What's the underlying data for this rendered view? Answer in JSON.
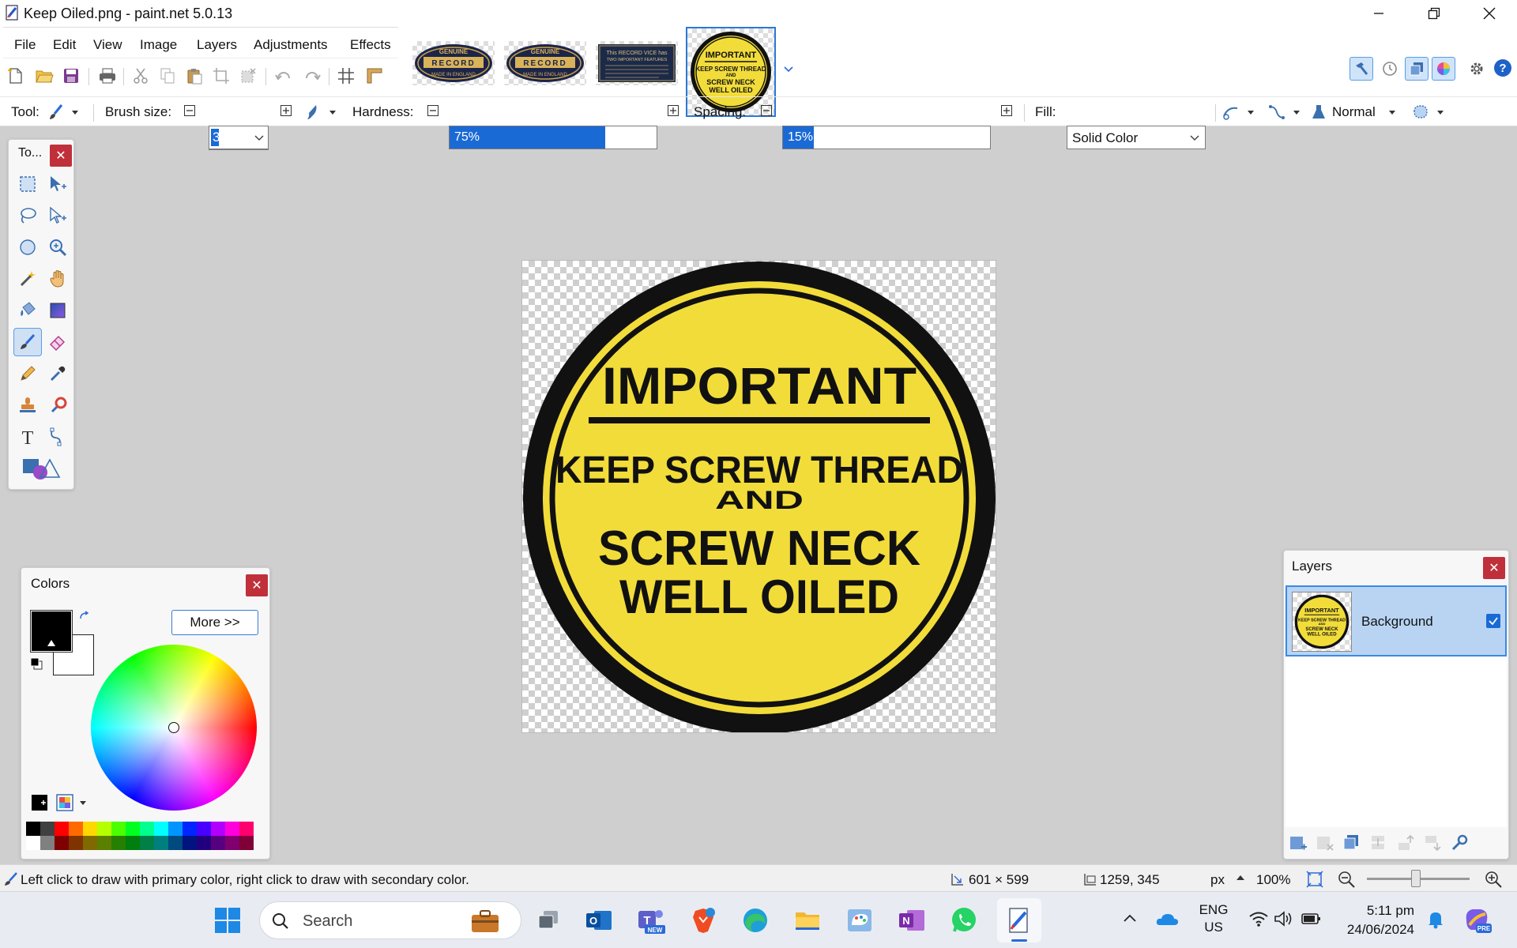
{
  "window": {
    "title": "Keep Oiled.png - paint.net 5.0.13",
    "minimize_icon": "minimize-icon",
    "maximize_icon": "restore-icon",
    "close_icon": "close-icon"
  },
  "menu": [
    "File",
    "Edit",
    "View",
    "Image",
    "Layers",
    "Adjustments",
    "Effects"
  ],
  "document_tabs": [
    {
      "name": "genuine-record-badge-1",
      "lines": [
        "GENUINE",
        "RECORD",
        "MADE IN ENGLAND"
      ]
    },
    {
      "name": "genuine-record-badge-2",
      "lines": [
        "GENUINE",
        "RECORD",
        "MADE IN ENGLAND"
      ]
    },
    {
      "name": "record-vice-plate",
      "lines": [
        "This RECORD VICE has",
        "TWO IMPORTANT FEATURES"
      ]
    },
    {
      "name": "keep-oiled-badge",
      "lines": [
        "IMPORTANT",
        "KEEP SCREW THREAD",
        "AND",
        "SCREW NECK",
        "WELL OILED"
      ],
      "active": true
    }
  ],
  "toolbar": {
    "tool_label": "Tool:",
    "brush_size_label": "Brush size:",
    "brush_size_value": "3",
    "hardness_label": "Hardness:",
    "hardness_value": "75%",
    "hardness_fraction": 0.75,
    "spacing_label": "Spacing:",
    "spacing_value": "15%",
    "spacing_fraction": 0.15,
    "fill_label": "Fill:",
    "fill_value": "Solid Color",
    "blend_mode": "Normal"
  },
  "tools_panel": {
    "title": "To...",
    "tools": [
      "rectangle-select",
      "move-selection",
      "lasso-select",
      "move-selected",
      "ellipse-select",
      "zoom",
      "magic-wand",
      "pan",
      "paint-bucket",
      "gradient",
      "paintbrush",
      "eraser",
      "pencil",
      "color-picker",
      "clone-stamp",
      "recolor",
      "text",
      "line-curve",
      "shapes"
    ]
  },
  "canvas_image": {
    "lines": [
      "IMPORTANT",
      "KEEP SCREW THREAD",
      "AND",
      "SCREW NECK",
      "WELL OILED"
    ],
    "fill_color": "#f2dc3a",
    "ring_color": "#111111"
  },
  "colors_panel": {
    "title": "Colors",
    "more_button": "More >>",
    "primary_color": "#000000",
    "secondary_color": "#ffffff",
    "palette_top": [
      "#000000",
      "#404040",
      "#ff0000",
      "#ff6a00",
      "#ffd800",
      "#b6ff00",
      "#4cff00",
      "#00ff21",
      "#00ff90",
      "#00ffff",
      "#0094ff",
      "#0026ff",
      "#4800ff",
      "#b200ff",
      "#ff00dc",
      "#ff006e"
    ],
    "palette_bottom": [
      "#ffffff",
      "#808080",
      "#7f0000",
      "#7f3300",
      "#7f6a00",
      "#5b7f00",
      "#267f00",
      "#007f0e",
      "#007f46",
      "#007f7f",
      "#004a7f",
      "#00137f",
      "#21007f",
      "#57007f",
      "#7f006e",
      "#7f0037"
    ]
  },
  "layers_panel": {
    "title": "Layers",
    "layers": [
      {
        "name": "Background",
        "visible": true
      }
    ]
  },
  "status_bar": {
    "hint": "Left click to draw with primary color, right click to draw with secondary color.",
    "image_size": "601 × 599",
    "cursor_pos": "1259, 345",
    "units": "px",
    "zoom": "100%"
  },
  "taskbar": {
    "search_placeholder": "Search",
    "language_line1": "ENG",
    "language_line2": "US",
    "time": "5:11 pm",
    "date": "24/06/2024",
    "new_badge": "NEW",
    "pre_badge": "PRE"
  }
}
